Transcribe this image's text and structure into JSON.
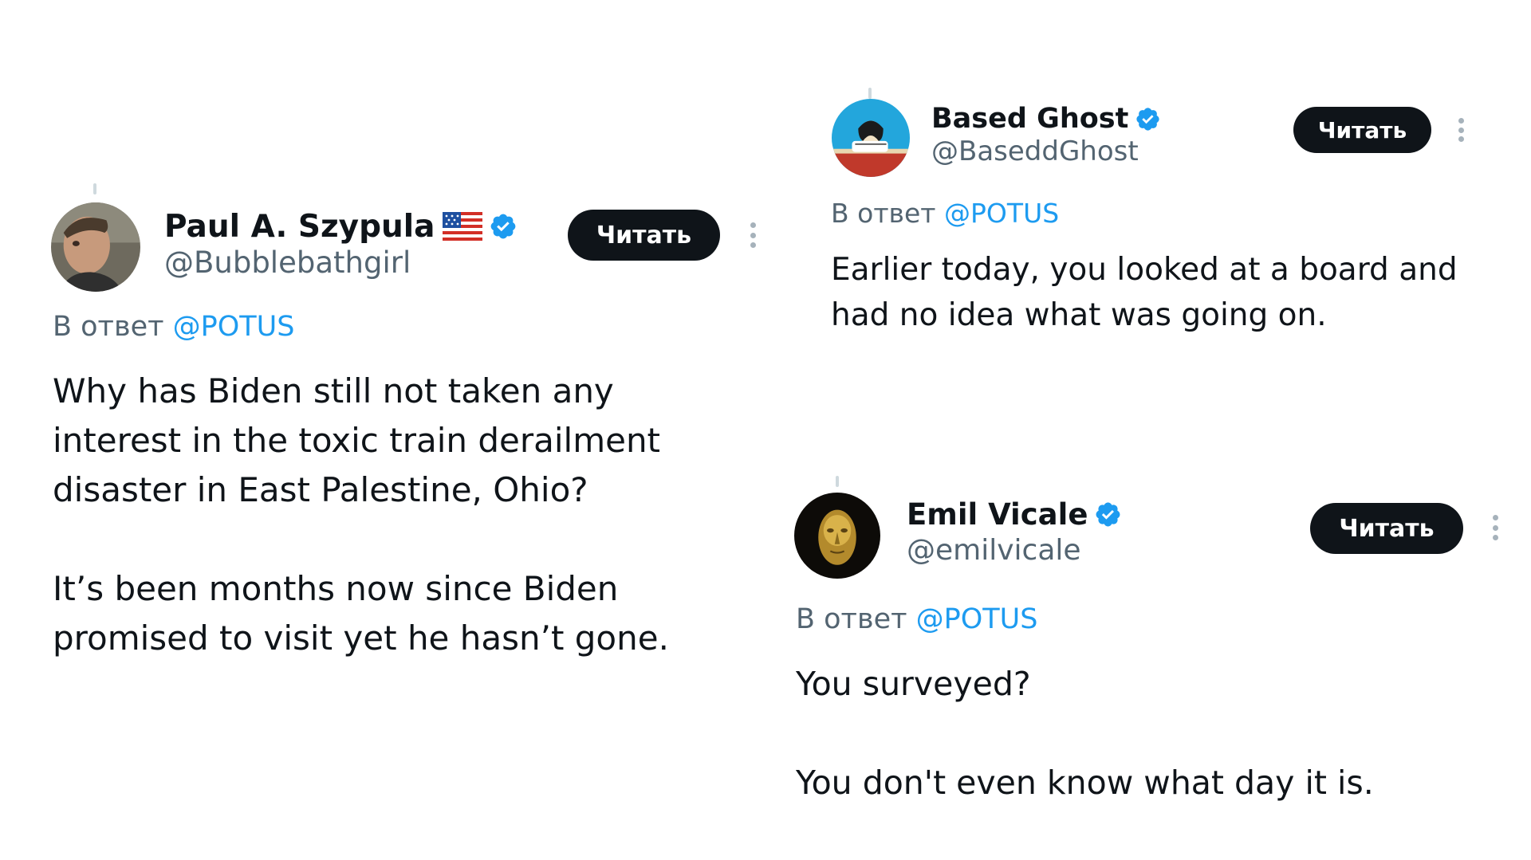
{
  "accent_color": "#1d9bf0",
  "tweets": [
    {
      "name": "Paul A. Szypula",
      "flag": "us-flag-icon",
      "verified": true,
      "handle": "@Bubblebathgirl",
      "follow_label": "Читать",
      "reply_prefix": "В ответ",
      "reply_mention": "@POTUS",
      "paragraphs": [
        "Why has Biden still not taken any interest in the toxic train derailment disaster in East Palestine, Ohio?",
        "It’s been months now since Biden promised to visit yet he hasn’t gone."
      ]
    },
    {
      "name": "Based Ghost",
      "verified": true,
      "handle": "@BaseddGhost",
      "follow_label": "Читать",
      "reply_prefix": "В ответ",
      "reply_mention": "@POTUS",
      "paragraphs": [
        "Earlier today, you looked at a board and had no idea what was going on."
      ]
    },
    {
      "name": "Emil Vicale",
      "verified": true,
      "handle": "@emilvicale",
      "follow_label": "Читать",
      "reply_prefix": "В ответ",
      "reply_mention": "@POTUS",
      "paragraphs": [
        "You surveyed?",
        "You don't even know what day it is."
      ]
    }
  ]
}
